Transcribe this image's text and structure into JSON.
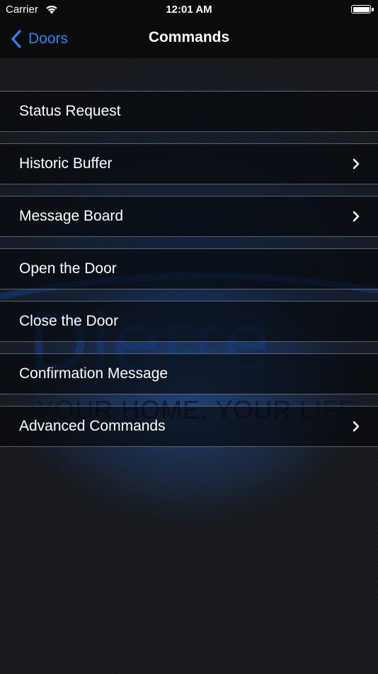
{
  "status_bar": {
    "carrier": "Carrier",
    "time": "12:01 AM",
    "battery_level": 1.0
  },
  "nav": {
    "back_label": "Doors",
    "title": "Commands"
  },
  "watermark": {
    "brand": "Dierre",
    "tagline": "YOUR HOME, YOUR LIFE"
  },
  "commands": [
    {
      "label": "Status Request",
      "has_chevron": false
    },
    {
      "label": "Historic Buffer",
      "has_chevron": true
    },
    {
      "label": "Message Board",
      "has_chevron": true
    },
    {
      "label": "Open the Door",
      "has_chevron": false
    },
    {
      "label": "Close the Door",
      "has_chevron": false
    },
    {
      "label": "Confirmation Message",
      "has_chevron": false
    },
    {
      "label": "Advanced Commands",
      "has_chevron": true
    }
  ],
  "colors": {
    "accent": "#1b8bf5",
    "bar_background": "#0b0b0c",
    "text": "#ffffff"
  },
  "icons": {
    "back": "chevron-left-icon",
    "disclosure": "chevron-right-icon",
    "wifi": "wifi-icon",
    "battery": "battery-icon"
  }
}
